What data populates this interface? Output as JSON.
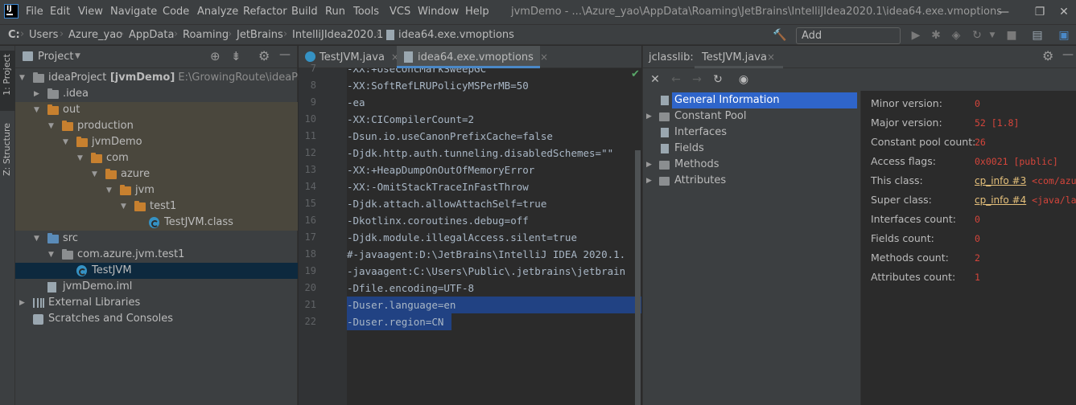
{
  "colors": {
    "accent": "#2f65ca",
    "excluded_bg": "#4a473d",
    "selection": "#214283",
    "value_red": "#d5453b",
    "link_yellow": "#e5c07b"
  },
  "menu": {
    "logo": "IJ",
    "items": [
      "File",
      "Edit",
      "View",
      "Navigate",
      "Code",
      "Analyze",
      "Refactor",
      "Build",
      "Run",
      "Tools",
      "VCS",
      "Window",
      "Help"
    ],
    "window_title": "jvmDemo - ...\\Azure_yao\\AppData\\Roaming\\JetBrains\\IntelliJIdea2020.1\\idea64.exe.vmoptions",
    "minimize": "—",
    "restore": "❐",
    "close": "✕"
  },
  "navbar": {
    "crumbs": [
      "C:",
      "Users",
      "Azure_yao",
      "AppData",
      "Roaming",
      "JetBrains",
      "IntelliJIdea2020.1",
      "idea64.exe.vmoptions"
    ],
    "add_config_label": "Add Configuration..."
  },
  "stripe": {
    "project_label": "1: Project",
    "structure_label": "Z: Structure"
  },
  "project": {
    "header_label": "Project",
    "tree": [
      {
        "label": "ideaProject",
        "bold": "[jvmDemo]",
        "path": "E:\\GrowingRoute\\ideaProject",
        "depth": 0,
        "arrow": "▼",
        "icon": "folder-grey"
      },
      {
        "label": ".idea",
        "depth": 1,
        "arrow": "▶",
        "icon": "folder-grey"
      },
      {
        "label": "out",
        "depth": 1,
        "arrow": "▼",
        "icon": "folder-orange",
        "excluded": true
      },
      {
        "label": "production",
        "depth": 2,
        "arrow": "▼",
        "icon": "folder-orange",
        "excluded": true
      },
      {
        "label": "jvmDemo",
        "depth": 3,
        "arrow": "▼",
        "icon": "folder-orange",
        "excluded": true
      },
      {
        "label": "com",
        "depth": 4,
        "arrow": "▼",
        "icon": "folder-orange",
        "excluded": true
      },
      {
        "label": "azure",
        "depth": 5,
        "arrow": "▼",
        "icon": "folder-orange",
        "excluded": true
      },
      {
        "label": "jvm",
        "depth": 6,
        "arrow": "▼",
        "icon": "folder-orange",
        "excluded": true
      },
      {
        "label": "test1",
        "depth": 7,
        "arrow": "▼",
        "icon": "folder-orange",
        "excluded": true
      },
      {
        "label": "TestJVM.class",
        "depth": 8,
        "arrow": "",
        "icon": "class",
        "excluded": true
      },
      {
        "label": "src",
        "depth": 1,
        "arrow": "▼",
        "icon": "folder-blue"
      },
      {
        "label": "com.azure.jvm.test1",
        "depth": 2,
        "arrow": "▼",
        "icon": "folder-grey"
      },
      {
        "label": "TestJVM",
        "depth": 3,
        "arrow": "",
        "icon": "class",
        "selected": true
      },
      {
        "label": "jvmDemo.iml",
        "depth": 1,
        "arrow": "",
        "icon": "iml"
      },
      {
        "label": "External Libraries",
        "depth": 0,
        "arrow": "▶",
        "icon": "lib"
      },
      {
        "label": "Scratches and Consoles",
        "depth": 0,
        "arrow": "",
        "icon": "scratch"
      }
    ]
  },
  "editor": {
    "tabs": [
      {
        "label": "TestJVM.java",
        "close": "×"
      },
      {
        "label": "idea64.exe.vmoptions",
        "close": "×"
      }
    ],
    "lines": [
      {
        "num": "7",
        "text": "-XX:+UseConcMarkSweepGC"
      },
      {
        "num": "8",
        "text": "-XX:SoftRefLRUPolicyMSPerMB=50"
      },
      {
        "num": "9",
        "text": "-ea"
      },
      {
        "num": "10",
        "text": "-XX:CICompilerCount=2"
      },
      {
        "num": "11",
        "text": "-Dsun.io.useCanonPrefixCache=false"
      },
      {
        "num": "12",
        "text": "-Djdk.http.auth.tunneling.disabledSchemes=\"\""
      },
      {
        "num": "13",
        "text": "-XX:+HeapDumpOnOutOfMemoryError"
      },
      {
        "num": "14",
        "text": "-XX:-OmitStackTraceInFastThrow"
      },
      {
        "num": "15",
        "text": "-Djdk.attach.allowAttachSelf=true"
      },
      {
        "num": "16",
        "text": "-Dkotlinx.coroutines.debug=off"
      },
      {
        "num": "17",
        "text": "-Djdk.module.illegalAccess.silent=true"
      },
      {
        "num": "18",
        "text": "#-javaagent:D:\\JetBrains\\IntelliJ IDEA 2020.1."
      },
      {
        "num": "19",
        "text": "-javaagent:C:\\Users\\Public\\.jetbrains\\jetbrain"
      },
      {
        "num": "20",
        "text": "-Dfile.encoding=UTF-8"
      },
      {
        "num": "21",
        "text": "-Duser.language=en"
      },
      {
        "num": "22",
        "text": "-Duser.region=CN"
      }
    ]
  },
  "jclasslib": {
    "header_prefix": "jclasslib:",
    "tab_label": "TestJVM.java",
    "tab_close": "×",
    "tree": [
      {
        "label": "General Information",
        "arrow": "",
        "icon": "file",
        "selected": true
      },
      {
        "label": "Constant Pool",
        "arrow": "▶",
        "icon": "folder"
      },
      {
        "label": "Interfaces",
        "arrow": "",
        "icon": "file"
      },
      {
        "label": "Fields",
        "arrow": "",
        "icon": "file"
      },
      {
        "label": "Methods",
        "arrow": "▶",
        "icon": "folder"
      },
      {
        "label": "Attributes",
        "arrow": "▶",
        "icon": "folder"
      }
    ],
    "info": [
      {
        "label": "Minor version:",
        "value": "0"
      },
      {
        "label": "Major version:",
        "value": "52 [1.8]"
      },
      {
        "label": "Constant pool count:",
        "value": "26"
      },
      {
        "label": "Access flags:",
        "value": "0x0021 [public]"
      },
      {
        "label": "This class:",
        "link": "cp_info #3",
        "value": "<com/azu"
      },
      {
        "label": "Super class:",
        "link": "cp_info #4",
        "value": "<java/la"
      },
      {
        "label": "Interfaces count:",
        "value": "0"
      },
      {
        "label": "Fields count:",
        "value": "0"
      },
      {
        "label": "Methods count:",
        "value": "2"
      },
      {
        "label": "Attributes count:",
        "value": "1"
      }
    ]
  }
}
